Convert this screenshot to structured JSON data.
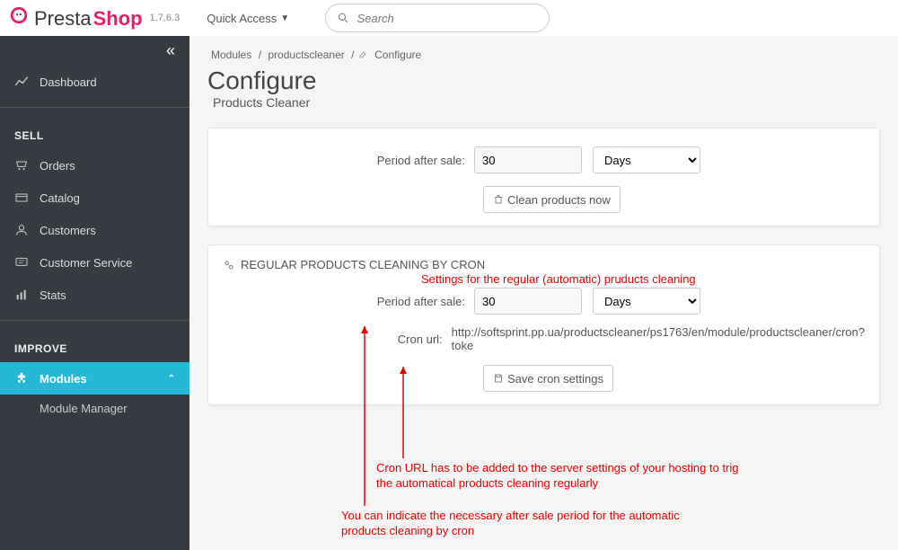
{
  "header": {
    "brand_a": "Presta",
    "brand_b": "Shop",
    "version": "1.7.6.3",
    "quick_access": "Quick Access",
    "search_placeholder": "Search"
  },
  "sidebar": {
    "dashboard": "Dashboard",
    "section_sell": "SELL",
    "orders": "Orders",
    "catalog": "Catalog",
    "customers": "Customers",
    "customer_service": "Customer Service",
    "stats": "Stats",
    "section_improve": "IMPROVE",
    "modules": "Modules",
    "module_manager": "Module Manager"
  },
  "breadcrumb": {
    "a": "Modules",
    "b": "productscleaner",
    "c": "Configure"
  },
  "page": {
    "title": "Configure",
    "subtitle": "Products Cleaner"
  },
  "panel1": {
    "period_label": "Period after sale:",
    "period_value": "30",
    "unit": "Days",
    "clean_btn": "Clean products now"
  },
  "panel2": {
    "heading": "REGULAR PRODUCTS CLEANING BY CRON",
    "period_label": "Period after sale:",
    "period_value": "30",
    "unit": "Days",
    "cron_label": "Cron url:",
    "cron_url": "http://softsprint.pp.ua/productscleaner/ps1763/en/module/productscleaner/cron?toke",
    "save_btn": "Save cron settings"
  },
  "annotations": {
    "a1": "Settings for the regular (automatic) pruducts cleaning",
    "a2": "Cron URL has to be added to the server settings of your hosting to trig the automatical products cleaning regularly",
    "a3": "You can indicate the necessary after sale period for the automatic products cleaning by cron"
  }
}
